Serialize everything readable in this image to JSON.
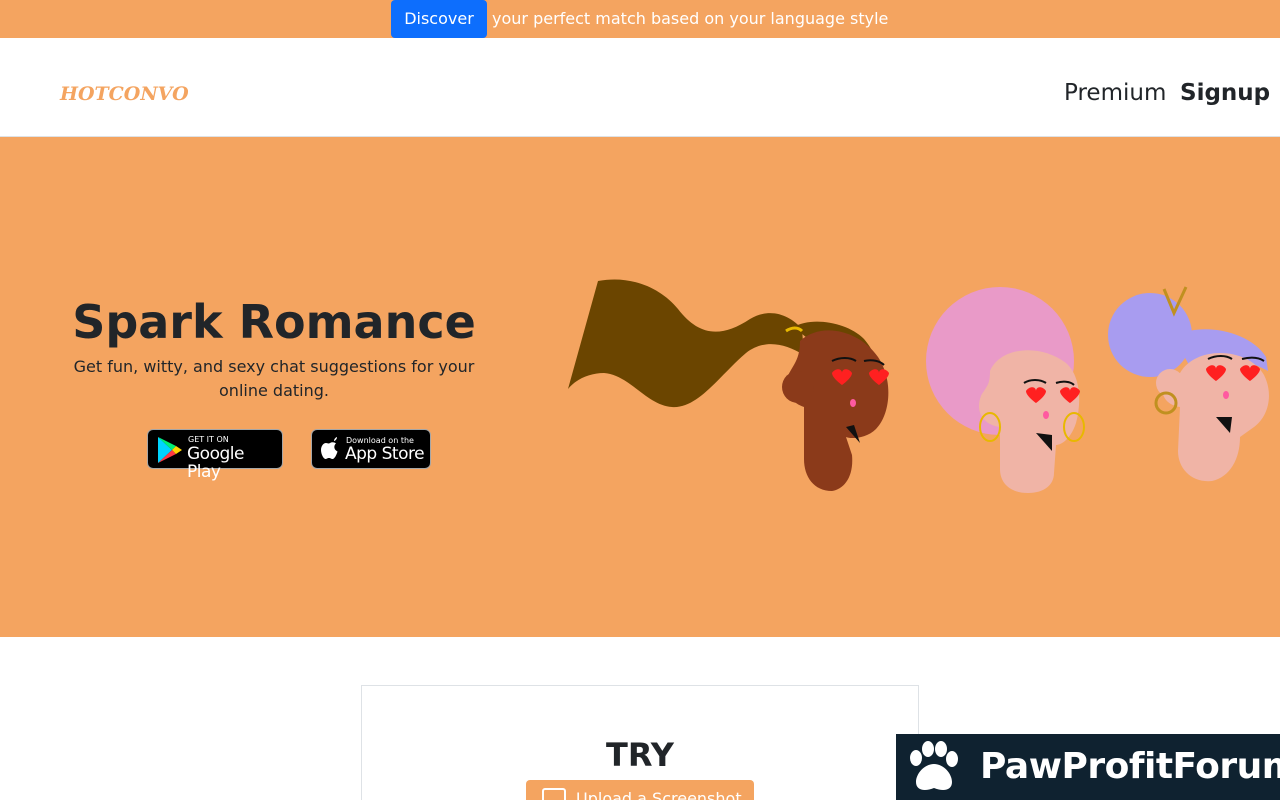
{
  "topbar": {
    "discover_label": "Discover",
    "text": "your perfect match based on your language style"
  },
  "nav": {
    "brand": "HOTCONVO",
    "premium": "Premium",
    "signup": "Signup"
  },
  "hero": {
    "title": "Spark Romance",
    "subtitle": "Get fun, witty, and sexy chat suggestions for your online dating.",
    "google_play": {
      "small": "GET IT ON",
      "big": "Google Play"
    },
    "app_store": {
      "small": "Download on the",
      "big": "App Store"
    }
  },
  "try": {
    "title": "TRY",
    "upload_label": "Upload a Screenshot"
  },
  "watermark": {
    "text": "PawProfitForum"
  },
  "colors": {
    "accent": "#f4a460",
    "primary_button": "#0d6efd",
    "watermark_bg": "#0f2230"
  }
}
